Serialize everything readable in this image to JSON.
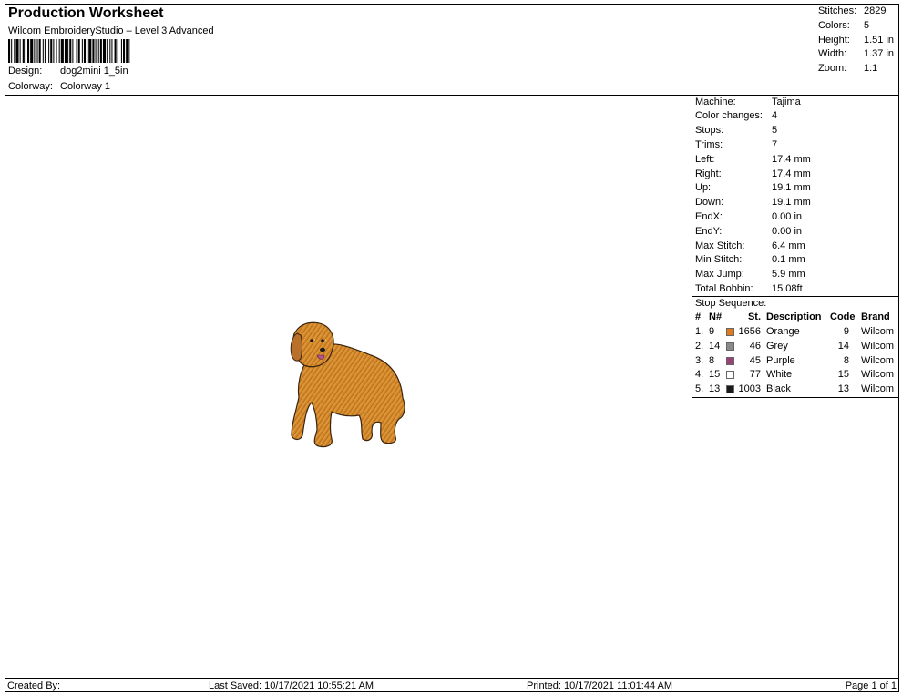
{
  "header": {
    "title": "Production Worksheet",
    "subtitle": "Wilcom EmbroideryStudio – Level 3 Advanced",
    "design_label": "Design:",
    "design_value": "dog2mini 1_5in",
    "colorway_label": "Colorway:",
    "colorway_value": "Colorway 1"
  },
  "stats": [
    {
      "label": "Stitches:",
      "value": "2829"
    },
    {
      "label": "Colors:",
      "value": "5"
    },
    {
      "label": "Height:",
      "value": "1.51 in"
    },
    {
      "label": "Width:",
      "value": "1.37 in"
    },
    {
      "label": "Zoom:",
      "value": "1:1"
    }
  ],
  "machine_info": [
    {
      "label": "Machine:",
      "value": "Tajima"
    },
    {
      "label": "Color changes:",
      "value": "4"
    },
    {
      "label": "Stops:",
      "value": "5"
    },
    {
      "label": "Trims:",
      "value": "7"
    },
    {
      "label": "Left:",
      "value": "17.4 mm"
    },
    {
      "label": "Right:",
      "value": "17.4 mm"
    },
    {
      "label": "Up:",
      "value": "19.1 mm"
    },
    {
      "label": "Down:",
      "value": "19.1 mm"
    },
    {
      "label": "EndX:",
      "value": "0.00 in"
    },
    {
      "label": "EndY:",
      "value": "0.00 in"
    },
    {
      "label": "Max Stitch:",
      "value": "6.4 mm"
    },
    {
      "label": "Min Stitch:",
      "value": "0.1 mm"
    },
    {
      "label": "Max Jump:",
      "value": "5.9 mm"
    },
    {
      "label": "Total Bobbin:",
      "value": "15.08ft"
    }
  ],
  "stop_sequence": {
    "title": "Stop Sequence:",
    "headers": {
      "num": "#",
      "n": "N#",
      "st": "St.",
      "description": "Description",
      "code": "Code",
      "brand": "Brand"
    },
    "rows": [
      {
        "num": "1.",
        "n": "9",
        "color": "#e07a1f",
        "st": "1656",
        "description": "Orange",
        "code": "9",
        "brand": "Wilcom"
      },
      {
        "num": "2.",
        "n": "14",
        "color": "#8a8a8a",
        "st": "46",
        "description": "Grey",
        "code": "14",
        "brand": "Wilcom"
      },
      {
        "num": "3.",
        "n": "8",
        "color": "#9b3f77",
        "st": "45",
        "description": "Purple",
        "code": "8",
        "brand": "Wilcom"
      },
      {
        "num": "4.",
        "n": "15",
        "color": "#ffffff",
        "st": "77",
        "description": "White",
        "code": "15",
        "brand": "Wilcom"
      },
      {
        "num": "5.",
        "n": "13",
        "color": "#1a1a1a",
        "st": "1003",
        "description": "Black",
        "code": "13",
        "brand": "Wilcom"
      }
    ]
  },
  "footer": {
    "created_by": "Created By:",
    "last_saved": "Last Saved: 10/17/2021 10:55:21 AM",
    "printed": "Printed: 10/17/2021 11:01:44 AM",
    "page": "Page 1 of 1"
  }
}
